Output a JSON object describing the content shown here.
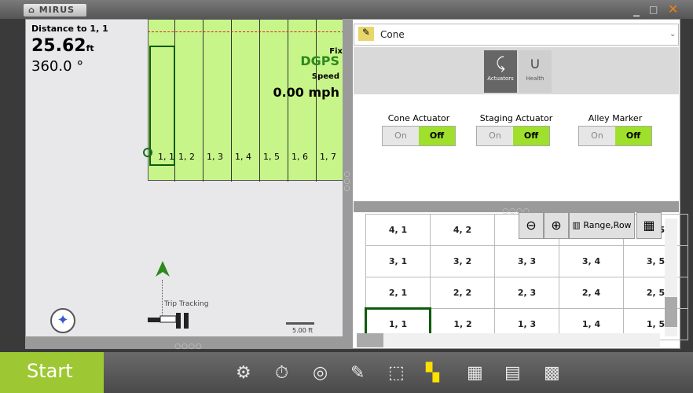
{
  "app": {
    "logo_text": "MIRUS"
  },
  "window": {
    "min": "_",
    "max": "□",
    "close": "✕"
  },
  "map": {
    "distance_label": "Distance to 1, 1",
    "distance_value": "25.62",
    "distance_unit": "ft",
    "heading": "360.0 °",
    "fix_label": "Fix",
    "fix_value": "DGPS",
    "speed_label": "Speed",
    "speed_value": "0.00 mph",
    "plots": [
      "1, 1",
      "1, 2",
      "1, 3",
      "1, 4",
      "1, 5",
      "1, 6",
      "1, 7"
    ],
    "trip_tracking": "Trip Tracking",
    "scale": "5.00 ft"
  },
  "right": {
    "plugin_name": "Cone",
    "tabs": [
      {
        "label": "Actuators"
      },
      {
        "label": "Health"
      }
    ],
    "actuators": [
      {
        "label": "Cone Actuator",
        "on": "On",
        "off": "Off"
      },
      {
        "label": "Staging Actuator",
        "on": "On",
        "off": "Off"
      },
      {
        "label": "Alley Marker",
        "on": "On",
        "off": "Off"
      }
    ],
    "range_row_label": "Range,Row",
    "grid": [
      [
        "4, 1",
        "4, 2",
        "",
        "",
        "4, 5"
      ],
      [
        "3, 1",
        "3, 2",
        "3, 3",
        "3, 4",
        "3, 5"
      ],
      [
        "2, 1",
        "2, 2",
        "2, 3",
        "2, 4",
        "2, 5"
      ],
      [
        "1, 1",
        "1, 2",
        "1, 3",
        "1, 4",
        "1, 5"
      ]
    ]
  },
  "bottom": {
    "start_label": "Start"
  },
  "colors": {
    "accent": "#9ee02b",
    "field": "#c8f58a",
    "start": "#9ec833"
  }
}
